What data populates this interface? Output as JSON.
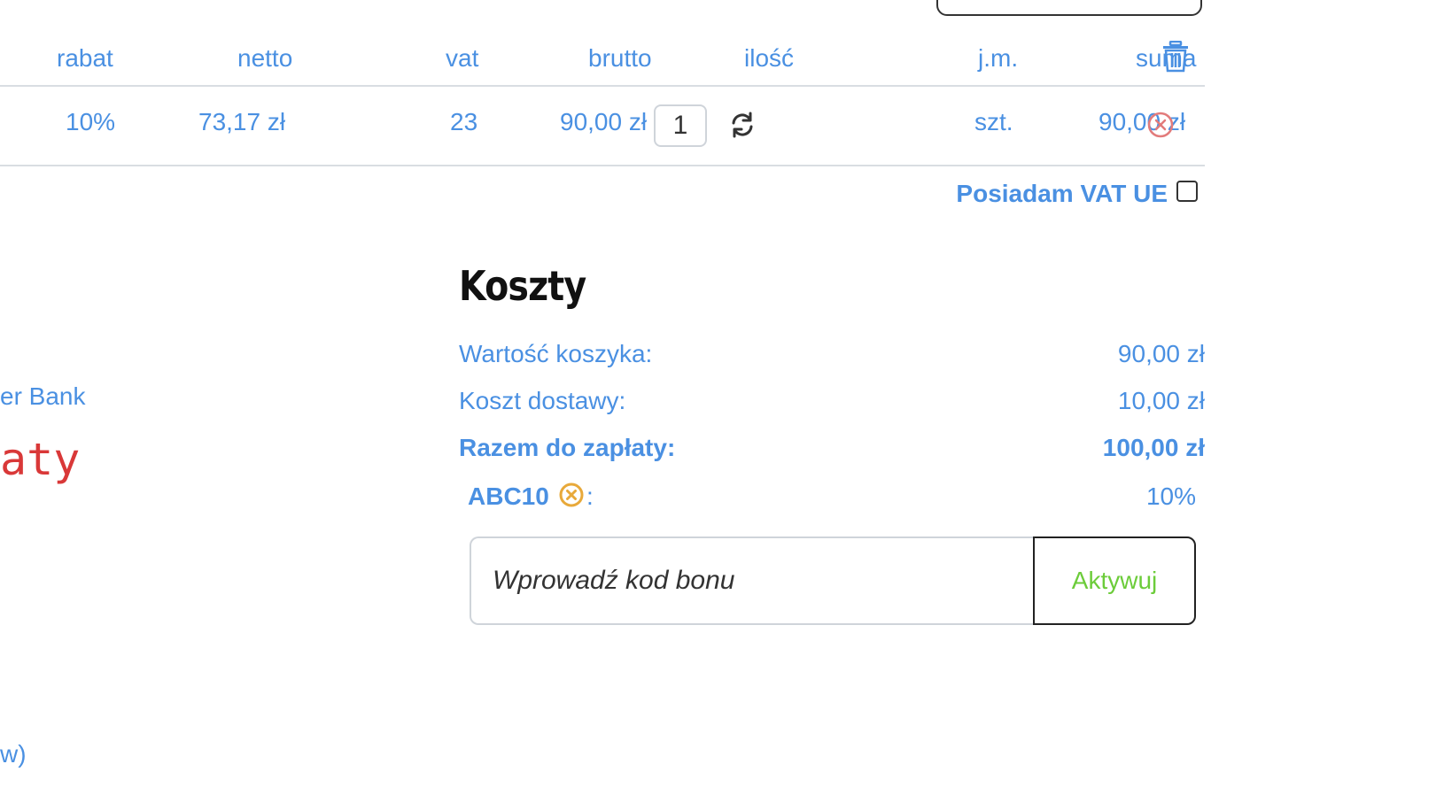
{
  "table": {
    "headers": {
      "rabat": "rabat",
      "netto": "netto",
      "vat": "vat",
      "brutto": "brutto",
      "ilosc": "ilość",
      "jm": "j.m.",
      "suma": "suma"
    },
    "row": {
      "rabat": "10%",
      "netto": "73,17 zł",
      "vat": "23",
      "brutto": "90,00 zł",
      "quantity": "1",
      "jm": "szt.",
      "suma": "90,00 zł"
    }
  },
  "vat_ue": {
    "label": "Posiadam VAT UE",
    "checked": false
  },
  "left_fragments": {
    "bank": "er Bank",
    "red_text": "aty",
    "bottom": "w)"
  },
  "costs": {
    "title": "Koszty",
    "rows": [
      {
        "label": "Wartość koszyka:",
        "value": "90,00 zł"
      },
      {
        "label": "Koszt dostawy:",
        "value": "10,00 zł"
      },
      {
        "label": "Razem do zapłaty:",
        "value": "100,00 zł"
      }
    ],
    "coupon": {
      "code": "ABC10",
      "colon": ":",
      "value": "10%"
    }
  },
  "voucher": {
    "placeholder": "Wprowadź kod bonu",
    "button_label": "Aktywuj"
  },
  "colors": {
    "accent": "#4a90e2",
    "danger": "#d93838",
    "success": "#6ccc3a",
    "coupon_icon": "#e8a93a"
  },
  "icons": [
    "trash-icon",
    "refresh-icon",
    "remove-circle-icon",
    "coupon-remove-icon"
  ]
}
